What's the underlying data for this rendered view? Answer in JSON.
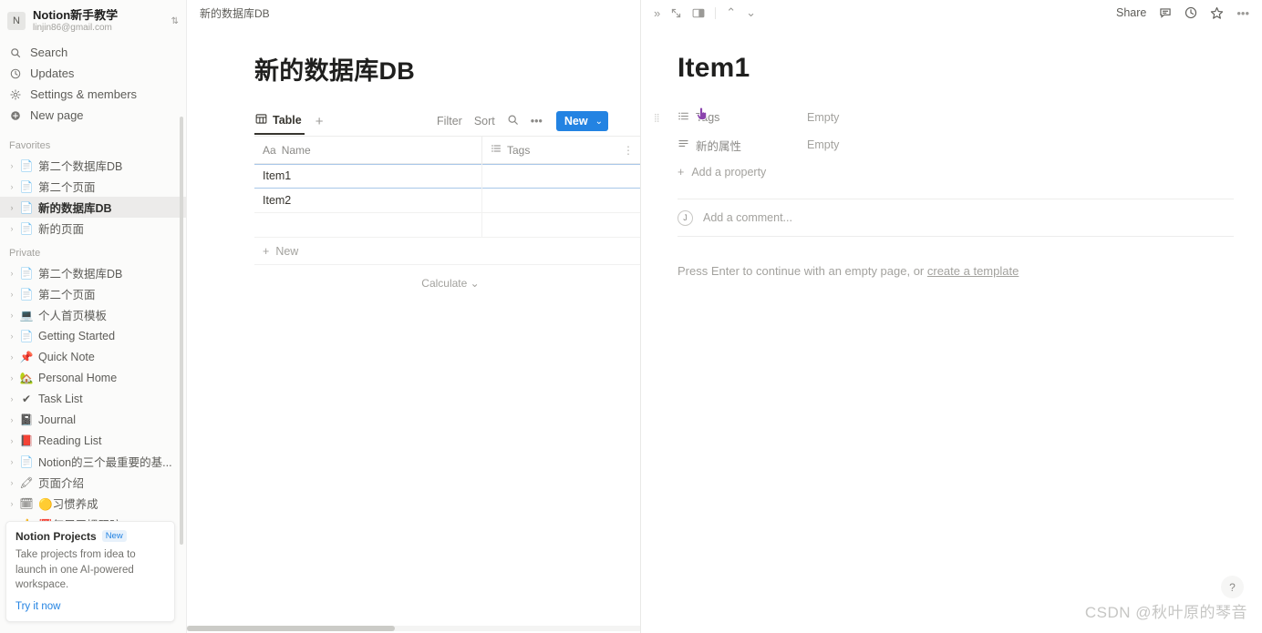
{
  "sidebar": {
    "workspace": {
      "avatar_letter": "N",
      "name": "Notion新手教学",
      "email": "linjin86@gmail.com"
    },
    "nav": [
      {
        "icon": "search-icon",
        "label": "Search"
      },
      {
        "icon": "clock-icon",
        "label": "Updates"
      },
      {
        "icon": "gear-icon",
        "label": "Settings & members"
      },
      {
        "icon": "plus-circle-icon",
        "label": "New page"
      }
    ],
    "favorites_title": "Favorites",
    "favorites": [
      {
        "icon": "📄",
        "label": "第二个数据库DB",
        "selected": false
      },
      {
        "icon": "📄",
        "label": "第二个页面",
        "selected": false
      },
      {
        "icon": "📄",
        "label": "新的数据库DB",
        "selected": true
      },
      {
        "icon": "📄",
        "label": "新的页面",
        "selected": false
      }
    ],
    "private_title": "Private",
    "private": [
      {
        "icon": "📄",
        "label": "第二个数据库DB"
      },
      {
        "icon": "📄",
        "label": "第二个页面"
      },
      {
        "icon": "💻",
        "label": "个人首页模板"
      },
      {
        "icon": "📄",
        "label": "Getting Started"
      },
      {
        "icon": "📌",
        "label": "Quick Note"
      },
      {
        "icon": "🏡",
        "label": "Personal Home"
      },
      {
        "icon": "✔",
        "label": "Task List"
      },
      {
        "icon": "📓",
        "label": "Journal"
      },
      {
        "icon": "📕",
        "label": "Reading List"
      },
      {
        "icon": "📄",
        "label": "Notion的三个最重要的基..."
      },
      {
        "icon": "🖍",
        "label": "页面介绍"
      },
      {
        "icon": "🗓",
        "label": "🟡习惯养成"
      },
      {
        "icon": "👍",
        "label": "📅每周习惯跟踪"
      }
    ],
    "promo": {
      "title": "Notion Projects",
      "badge": "New",
      "body": "Take projects from idea to launch in one AI-powered workspace.",
      "link": "Try it now"
    }
  },
  "middle": {
    "breadcrumb": "新的数据库DB",
    "db_title": "新的数据库DB",
    "tab_label": "Table",
    "tab_add": "+",
    "toolbar": {
      "filter": "Filter",
      "sort": "Sort",
      "search_icon": "search-icon",
      "more_icon": "ellipsis-icon",
      "new_label": "New",
      "new_caret": "⌄"
    },
    "columns": [
      {
        "icon": "Aa",
        "label": "Name"
      },
      {
        "icon": "list-icon",
        "label": "Tags"
      }
    ],
    "rows": [
      {
        "name": "Item1",
        "tags": "",
        "selected": true
      },
      {
        "name": "Item2",
        "tags": "",
        "selected": false
      },
      {
        "name": "",
        "tags": "",
        "selected": false
      }
    ],
    "new_row_label": "New",
    "calculate_label": "Calculate"
  },
  "peek": {
    "toolbar_left": [
      {
        "icon": "chevrons-right-icon",
        "glyph": "»"
      },
      {
        "icon": "expand-diagonal-icon",
        "glyph": "⤡"
      },
      {
        "icon": "side-peek-icon",
        "glyph": "▣"
      }
    ],
    "nav_up": "⌃",
    "nav_down": "⌄",
    "share_label": "Share",
    "toolbar_right": [
      {
        "icon": "comment-icon",
        "glyph": "💬"
      },
      {
        "icon": "history-clock-icon",
        "glyph": "🕘"
      },
      {
        "icon": "star-icon",
        "glyph": "☆"
      },
      {
        "icon": "ellipsis-icon",
        "glyph": "•••"
      }
    ],
    "page_title": "Item1",
    "properties": [
      {
        "icon": "multi-select-icon",
        "label": "Tags",
        "value": "Empty"
      },
      {
        "icon": "text-icon",
        "label": "新的属性",
        "value": "Empty"
      }
    ],
    "add_property_label": "Add a property",
    "comment_avatar": "J",
    "comment_placeholder": "Add a comment...",
    "hint_prefix": "Press Enter to continue with an empty page, or ",
    "hint_link": "create a template"
  },
  "overlay": {
    "watermark": "CSDN @秋叶原的琴音",
    "help_label": "?"
  },
  "colors": {
    "accent_blue": "#2383e2",
    "sidebar_bg": "#fbfbfa",
    "selected_row_border": "#a8c7e8"
  }
}
